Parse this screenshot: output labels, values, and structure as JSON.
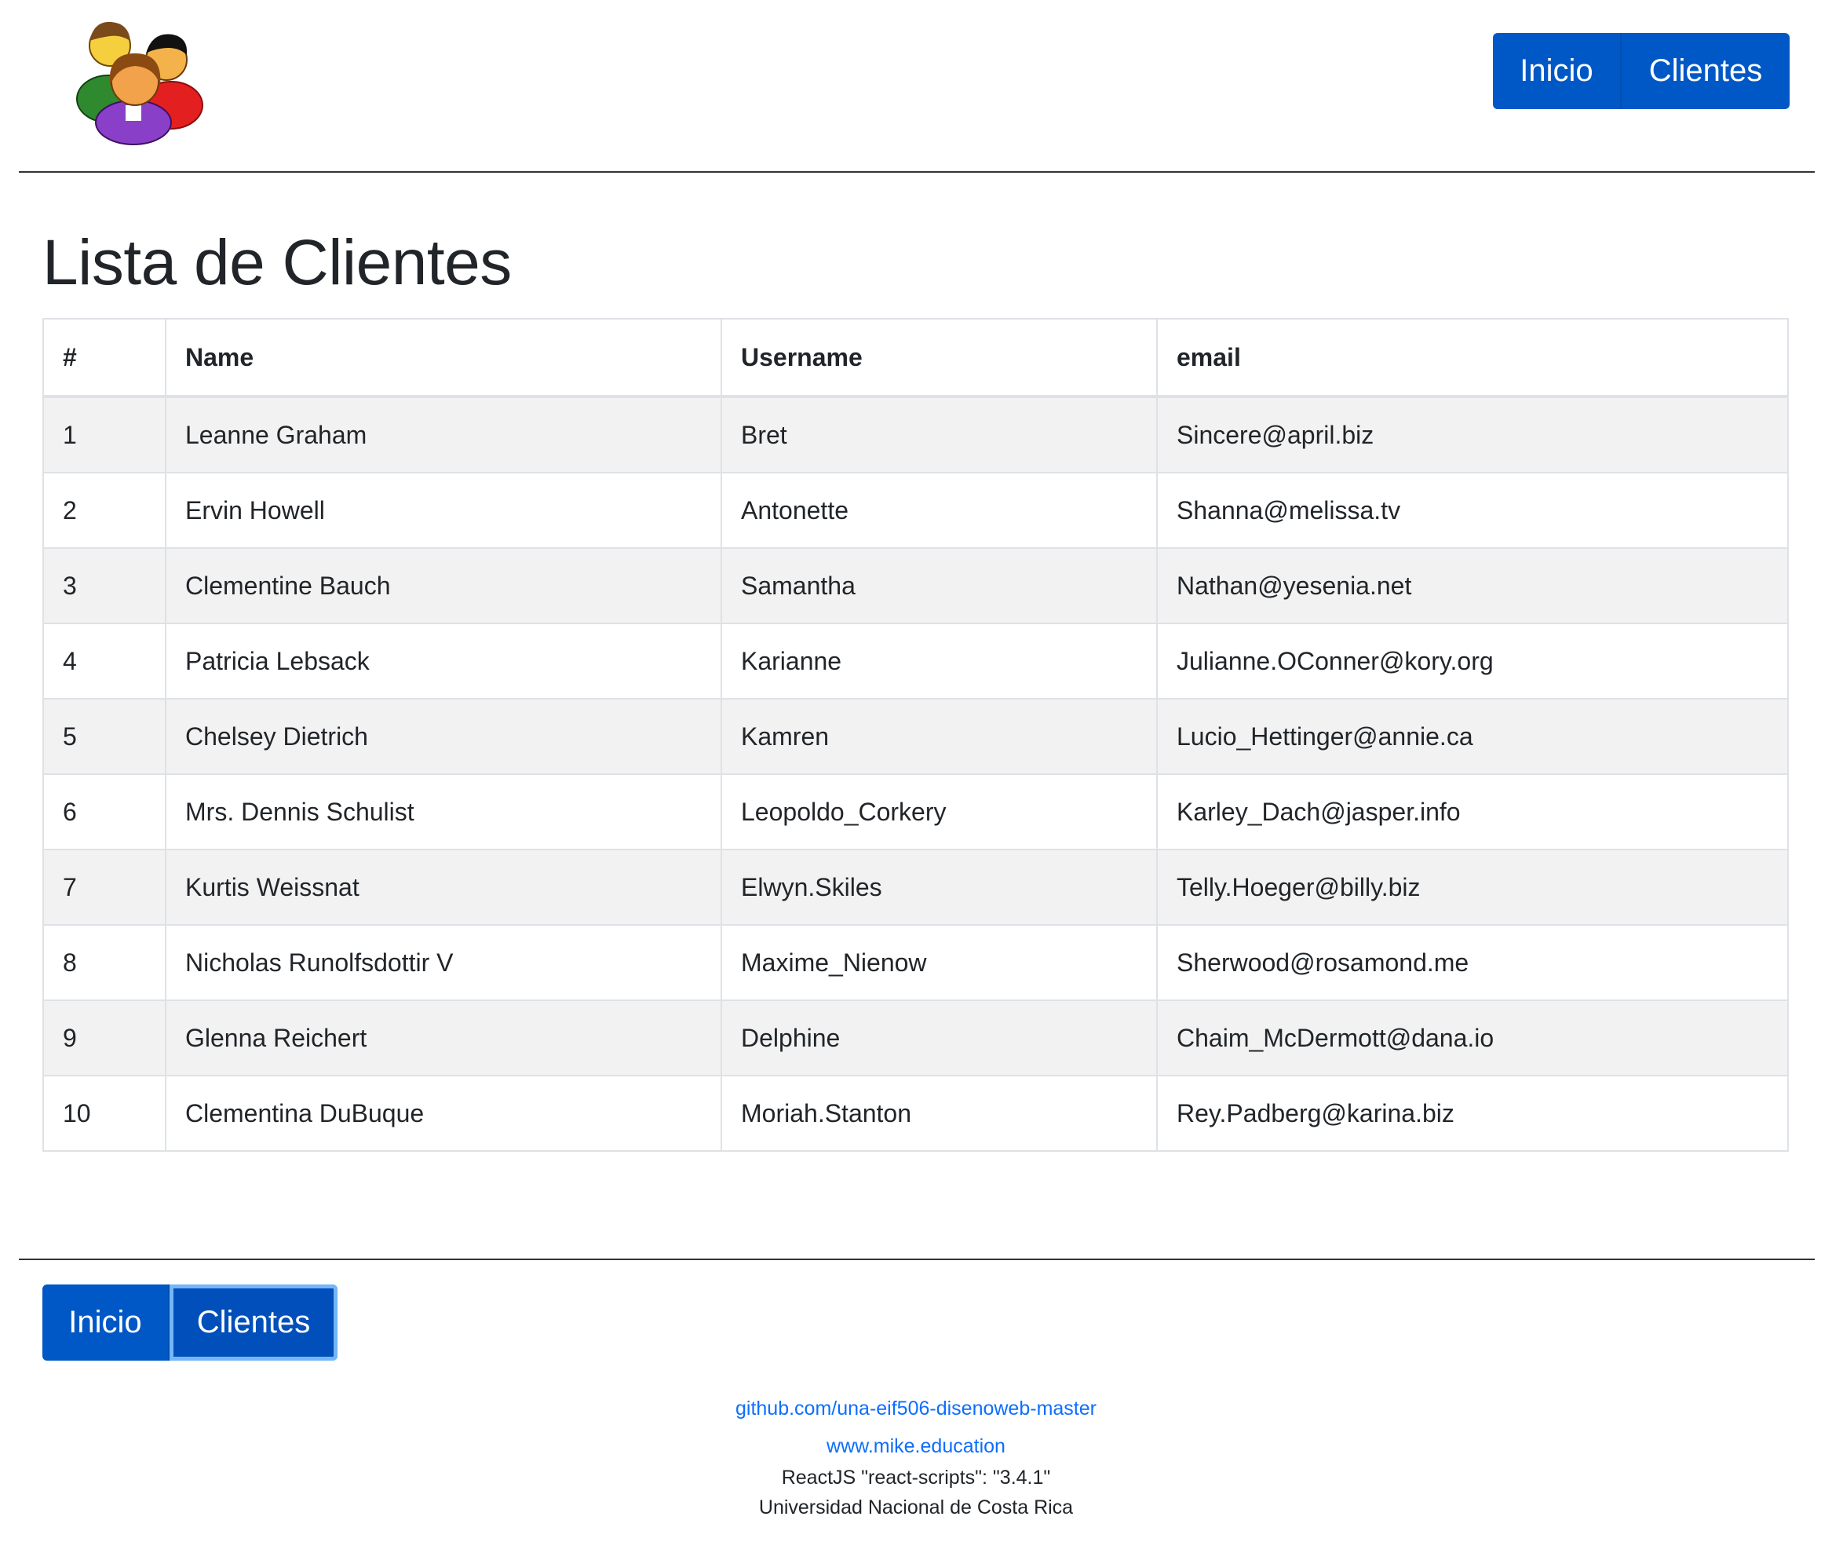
{
  "nav": {
    "top": {
      "inicio": "Inicio",
      "clientes": "Clientes"
    },
    "bottom": {
      "inicio": "Inicio",
      "clientes": "Clientes"
    }
  },
  "logo": {
    "icon": "users-group-icon"
  },
  "main": {
    "title": "Lista de Clientes",
    "table": {
      "headers": [
        "#",
        "Name",
        "Username",
        "email"
      ],
      "rows": [
        [
          "1",
          "Leanne Graham",
          "Bret",
          "Sincere@april.biz"
        ],
        [
          "2",
          "Ervin Howell",
          "Antonette",
          "Shanna@melissa.tv"
        ],
        [
          "3",
          "Clementine Bauch",
          "Samantha",
          "Nathan@yesenia.net"
        ],
        [
          "4",
          "Patricia Lebsack",
          "Karianne",
          "Julianne.OConner@kory.org"
        ],
        [
          "5",
          "Chelsey Dietrich",
          "Kamren",
          "Lucio_Hettinger@annie.ca"
        ],
        [
          "6",
          "Mrs. Dennis Schulist",
          "Leopoldo_Corkery",
          "Karley_Dach@jasper.info"
        ],
        [
          "7",
          "Kurtis Weissnat",
          "Elwyn.Skiles",
          "Telly.Hoeger@billy.biz"
        ],
        [
          "8",
          "Nicholas Runolfsdottir V",
          "Maxime_Nienow",
          "Sherwood@rosamond.me"
        ],
        [
          "9",
          "Glenna Reichert",
          "Delphine",
          "Chaim_McDermott@dana.io"
        ],
        [
          "10",
          "Clementina DuBuque",
          "Moriah.Stanton",
          "Rey.Padberg@karina.biz"
        ]
      ]
    }
  },
  "footer": {
    "repo_link": "github.com/una-eif506-disenoweb-master",
    "site_link": "www.mike.education",
    "react_info": "ReactJS \"react-scripts\": \"3.4.1\"",
    "university": "Universidad Nacional de Costa Rica"
  },
  "colors": {
    "primary": "#0058c6",
    "link": "#0d6efd",
    "stripe": "#f2f2f2"
  }
}
